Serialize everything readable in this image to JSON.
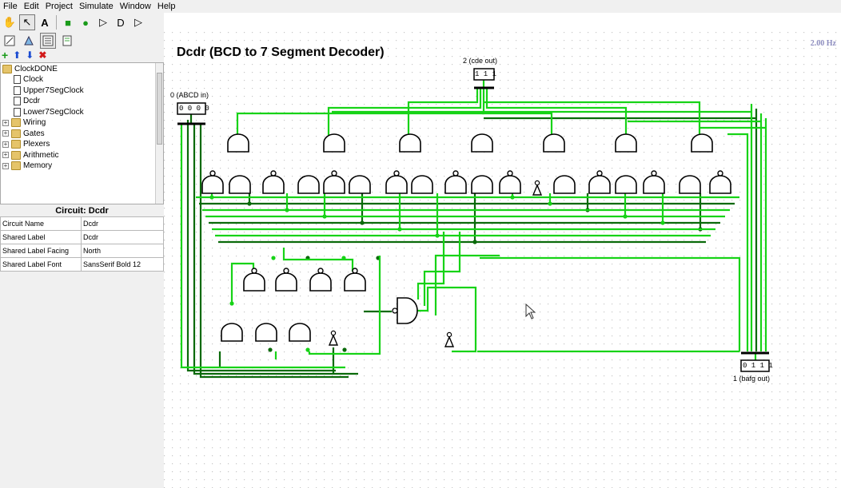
{
  "menu": [
    "File",
    "Edit",
    "Project",
    "Simulate",
    "Window",
    "Help"
  ],
  "toolbar": {
    "tools": [
      {
        "name": "poke-tool-icon",
        "glyph": "✋"
      },
      {
        "name": "select-tool-icon",
        "glyph": "↖",
        "selected": true
      },
      {
        "name": "text-tool-icon",
        "glyph": "A"
      },
      {
        "name": "input-pin-icon",
        "glyph": "■"
      },
      {
        "name": "output-pin-icon",
        "glyph": "●"
      },
      {
        "name": "not-gate-icon",
        "glyph": "▷"
      },
      {
        "name": "and-gate-icon",
        "glyph": "D"
      },
      {
        "name": "or-gate-icon",
        "glyph": "▷"
      }
    ]
  },
  "explorer": {
    "root": "ClockDONE",
    "circuits": [
      "Clock",
      "Upper7SegClock",
      "Dcdr",
      "Lower7SegClock"
    ],
    "libraries": [
      "Wiring",
      "Gates",
      "Plexers",
      "Arithmetic",
      "Memory"
    ]
  },
  "attributes": {
    "title": "Circuit: Dcdr",
    "rows": [
      {
        "key": "Circuit Name",
        "value": "Dcdr"
      },
      {
        "key": "Shared Label",
        "value": "Dcdr"
      },
      {
        "key": "Shared Label Facing",
        "value": "North"
      },
      {
        "key": "Shared Label Font",
        "value": "SansSerif Bold 12"
      }
    ]
  },
  "canvas": {
    "frequency": "2.00 Hz",
    "title": "Dcdr (BCD to 7 Segment Decoder)",
    "input_label": "0 (ABCD in)",
    "input_value": "0 0 0 0",
    "cde_label": "2 (cde out)",
    "cde_value": "1 1 1",
    "bafg_label": "1 (bafg out)",
    "bafg_value": "0 1 1 1",
    "colors": {
      "wire_on": "#17d317",
      "wire_off": "#0a6a0a",
      "gate": "#000000",
      "grid": "#c9c9c9"
    }
  }
}
